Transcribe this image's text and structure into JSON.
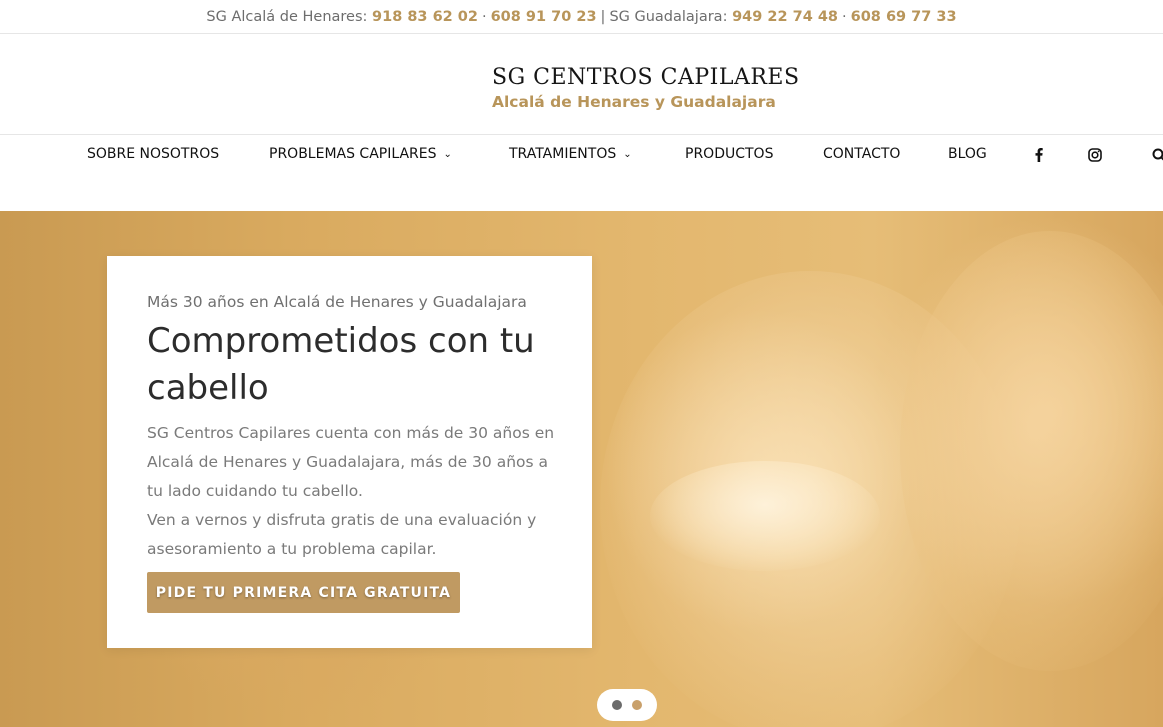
{
  "topbar": {
    "alcala_label": "SG Alcalá de Henares:",
    "alcala_phone1": "918 83 62 02",
    "dot_sep": "·",
    "alcala_phone2": "608 91 70 23",
    "bar_sep": "|",
    "guadalajara_label": "SG Guadalajara:",
    "guadalajara_phone1": "949 22 74 48",
    "guadalajara_phone2": "608 69 77 33"
  },
  "logo": {
    "title": "SG CENTROS CAPILARES",
    "subtitle": "Alcalá de Henares y Guadalajara"
  },
  "nav": {
    "items": [
      {
        "label": "SOBRE NOSOTROS"
      },
      {
        "label": "PROBLEMAS CAPILARES"
      },
      {
        "label": "TRATAMIENTOS"
      },
      {
        "label": "PRODUCTOS"
      },
      {
        "label": "CONTACTO"
      },
      {
        "label": "BLOG"
      }
    ],
    "icons": [
      "facebook-icon",
      "instagram-icon",
      "search-icon"
    ]
  },
  "hero": {
    "kicker": "Más 30 años en Alcalá de Henares y Guadalajara",
    "title": "Comprometidos con tu cabello",
    "paragraph1": "SG Centros Capilares cuenta con más de 30 años en Alcalá de Henares y Guadalajara, más de 30 años a tu lado cuidando tu cabello.",
    "paragraph2": "Ven a vernos y disfruta gratis de una evaluación y asesoramiento a tu problema capilar.",
    "cta_label": "PIDE TU PRIMERA CITA GRATUITA",
    "slider_active_index": 2,
    "slider_count": 2
  },
  "colors": {
    "accent": "#b8955a",
    "button": "#c09a62",
    "dot_inactive": "#6b6b6b",
    "dot_active": "#c9a06a"
  }
}
